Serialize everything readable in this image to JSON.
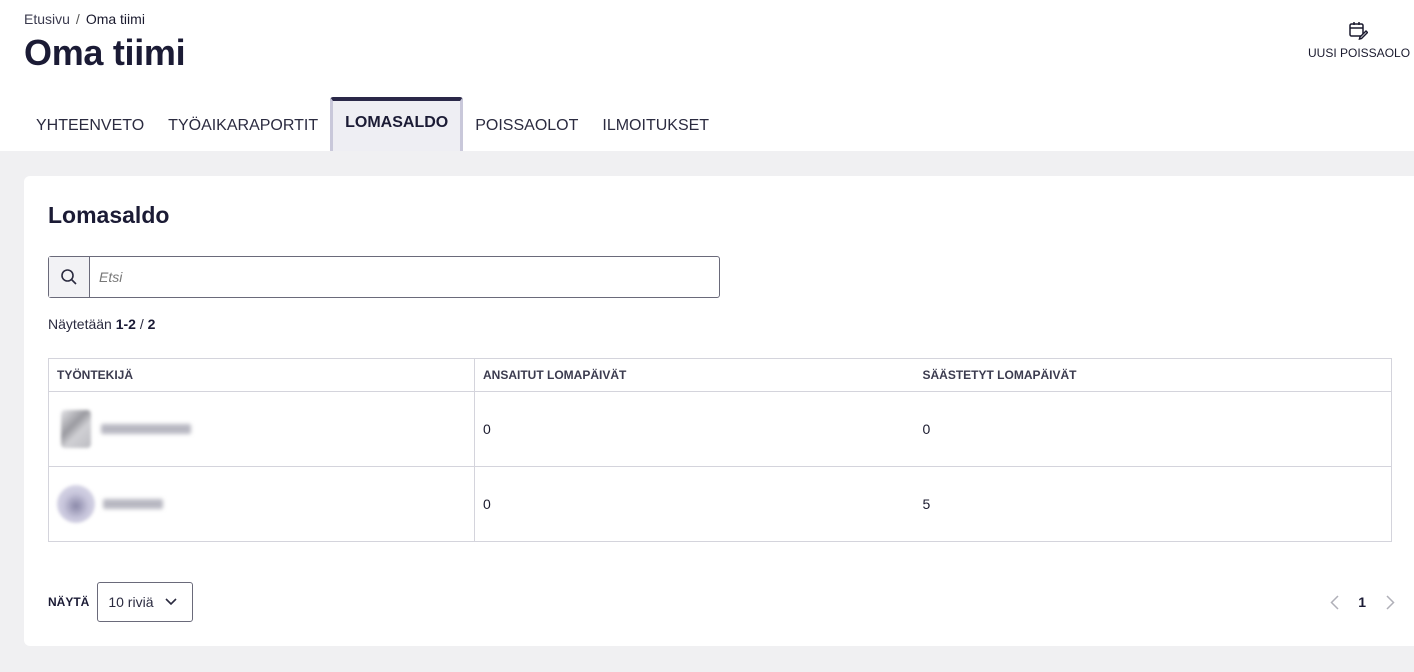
{
  "breadcrumb": {
    "home": "Etusivu",
    "separator": "/",
    "current": "Oma tiimi"
  },
  "page": {
    "title": "Oma tiimi"
  },
  "actions": {
    "new_absence_label": "UUSI POISSAOLO",
    "new_absence_icon": "calendar-edit-icon"
  },
  "tabs": [
    {
      "label": "YHTEENVETO",
      "active": false
    },
    {
      "label": "TYÖAIKARAPORTIT",
      "active": false
    },
    {
      "label": "LOMASALDO",
      "active": true
    },
    {
      "label": "POISSAOLOT",
      "active": false
    },
    {
      "label": "ILMOITUKSET",
      "active": false
    }
  ],
  "card": {
    "title": "Lomasaldo",
    "search": {
      "placeholder": "Etsi",
      "value": "",
      "icon": "search-icon"
    },
    "showing": {
      "prefix": "Näytetään",
      "range": "1-2",
      "separator": "/",
      "total": "2"
    },
    "table": {
      "headers": [
        "TYÖNTEKIJÄ",
        "ANSAITUT LOMAPÄIVÄT",
        "SÄÄSTETYT LOMAPÄIVÄT"
      ],
      "rows": [
        {
          "earned": "0",
          "saved": "0"
        },
        {
          "earned": "0",
          "saved": "5"
        }
      ]
    },
    "footer": {
      "show_label": "NÄYTÄ",
      "rows_select": "10 riviä",
      "current_page": "1"
    }
  },
  "colors": {
    "title": "#1b1b35",
    "active_tab_border": "#2a2848",
    "content_bg": "#f0f0f2"
  }
}
